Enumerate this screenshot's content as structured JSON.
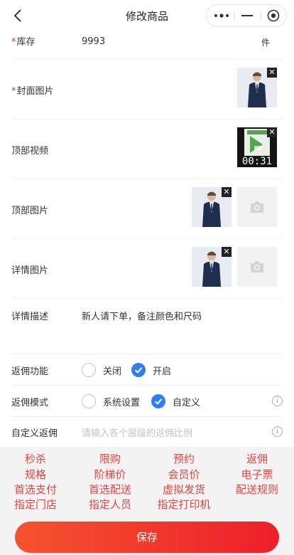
{
  "nav": {
    "title": "修改商品"
  },
  "form": {
    "stock": {
      "label": "库存",
      "value": "9993",
      "unit": "件"
    },
    "cover": {
      "label": "封面图片"
    },
    "top_video": {
      "label": "顶部视频",
      "duration": "00:31"
    },
    "top_images": {
      "label": "顶部图片"
    },
    "detail_images": {
      "label": "详情图片"
    },
    "description": {
      "label": "详情描述",
      "value": "新人请下单，备注颜色和尺码"
    },
    "commission": {
      "label": "返佣功能",
      "options": [
        "关闭",
        "开启"
      ],
      "selected": "开启"
    },
    "commission_mode": {
      "label": "返佣模式",
      "options": [
        "系统设置",
        "自定义"
      ],
      "selected": "自定义"
    },
    "custom_commission": {
      "label": "自定义返佣",
      "placeholder": "请输入各个层级的返佣比例"
    }
  },
  "toolbar": {
    "rows": [
      [
        "秒杀",
        "限购",
        "预约",
        "返佣"
      ],
      [
        "规格",
        "阶梯价",
        "会员价",
        "电子票"
      ],
      [
        "首选支付",
        "首选配送",
        "虚拟发货",
        "配送规则"
      ],
      [
        "指定门店",
        "指定人员",
        "指定打印机"
      ]
    ]
  },
  "save_label": "保存",
  "colors": {
    "accent": "#e64340",
    "check": "#2f7ff3",
    "button_start": "#f4532f",
    "button_end": "#ee1f2a"
  },
  "icons": {
    "back": "chevron-left-icon",
    "more": "more-dots-icon",
    "minimize": "minimize-icon",
    "close": "target-close-icon",
    "delete": "close-x-icon",
    "upload": "camera-icon",
    "info": "info-icon"
  }
}
